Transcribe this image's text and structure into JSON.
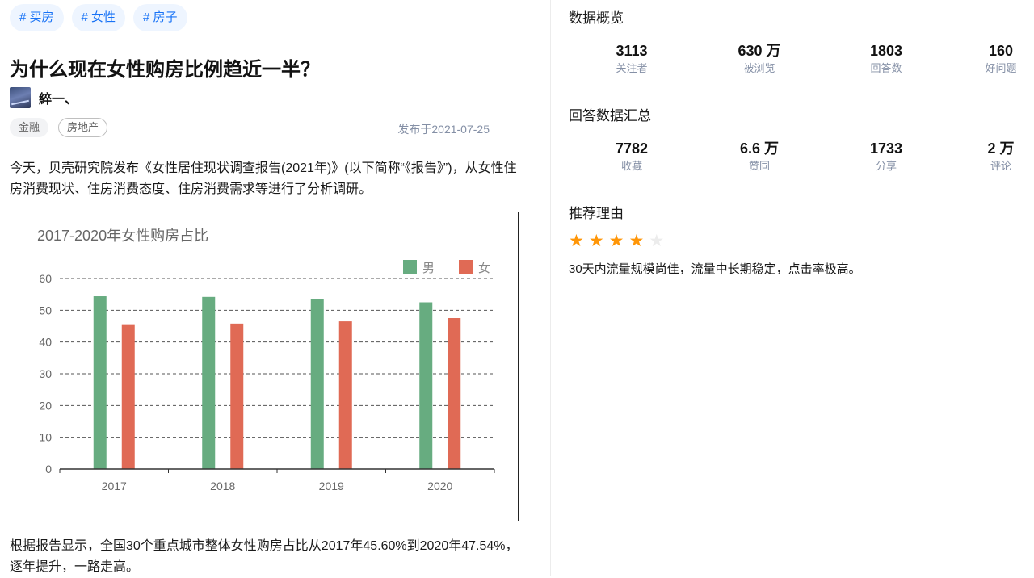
{
  "tags": [
    "# 买房",
    "# 女性",
    "# 房子"
  ],
  "article": {
    "title": "为什么现在女性购房比例趋近一半？",
    "author": "綷一、",
    "topics": [
      "金融",
      "房地产"
    ],
    "published": "发布于2021-07-25",
    "para1": "今天，贝壳研究院发布《女性居住现状调查报告(2021年)》(以下简称“《报告》”)，从女性住房消费现状、住房消费态度、住房消费需求等进行了分析调研。",
    "para2": "根据报告显示，全国30个重点城市整体女性购房占比从2017年45.60%到2020年47.54%，逐年提升，一路走高。"
  },
  "chart_data": {
    "type": "bar",
    "title": "2017-2020年女性购房占比",
    "categories": [
      "2017",
      "2018",
      "2019",
      "2020"
    ],
    "series": [
      {
        "name": "男",
        "color": "#67ac80",
        "values": [
          54.4,
          54.2,
          53.5,
          52.5
        ]
      },
      {
        "name": "女",
        "color": "#e06a55",
        "values": [
          45.6,
          45.8,
          46.5,
          47.54
        ]
      }
    ],
    "ylim": [
      0,
      60
    ],
    "yticks": [
      "0",
      "10",
      "20",
      "30",
      "40",
      "50",
      "60"
    ],
    "grid": true,
    "legend": "top-right"
  },
  "overview": {
    "title": "数据概览",
    "stats": [
      {
        "value": "3113",
        "label": "关注者"
      },
      {
        "value": "630 万",
        "label": "被浏览"
      },
      {
        "value": "1803",
        "label": "回答数"
      },
      {
        "value": "160",
        "label": "好问题"
      }
    ]
  },
  "answers": {
    "title": "回答数据汇总",
    "stats": [
      {
        "value": "7782",
        "label": "收藏"
      },
      {
        "value": "6.6 万",
        "label": "赞同"
      },
      {
        "value": "1733",
        "label": "分享"
      },
      {
        "value": "2 万",
        "label": "评论"
      }
    ]
  },
  "recommend": {
    "title": "推荐理由",
    "rating": 4,
    "max_rating": 5,
    "star_color": "#ff9607",
    "text": "30天内流量规模尚佳，流量中长期稳定，点击率极高。"
  }
}
